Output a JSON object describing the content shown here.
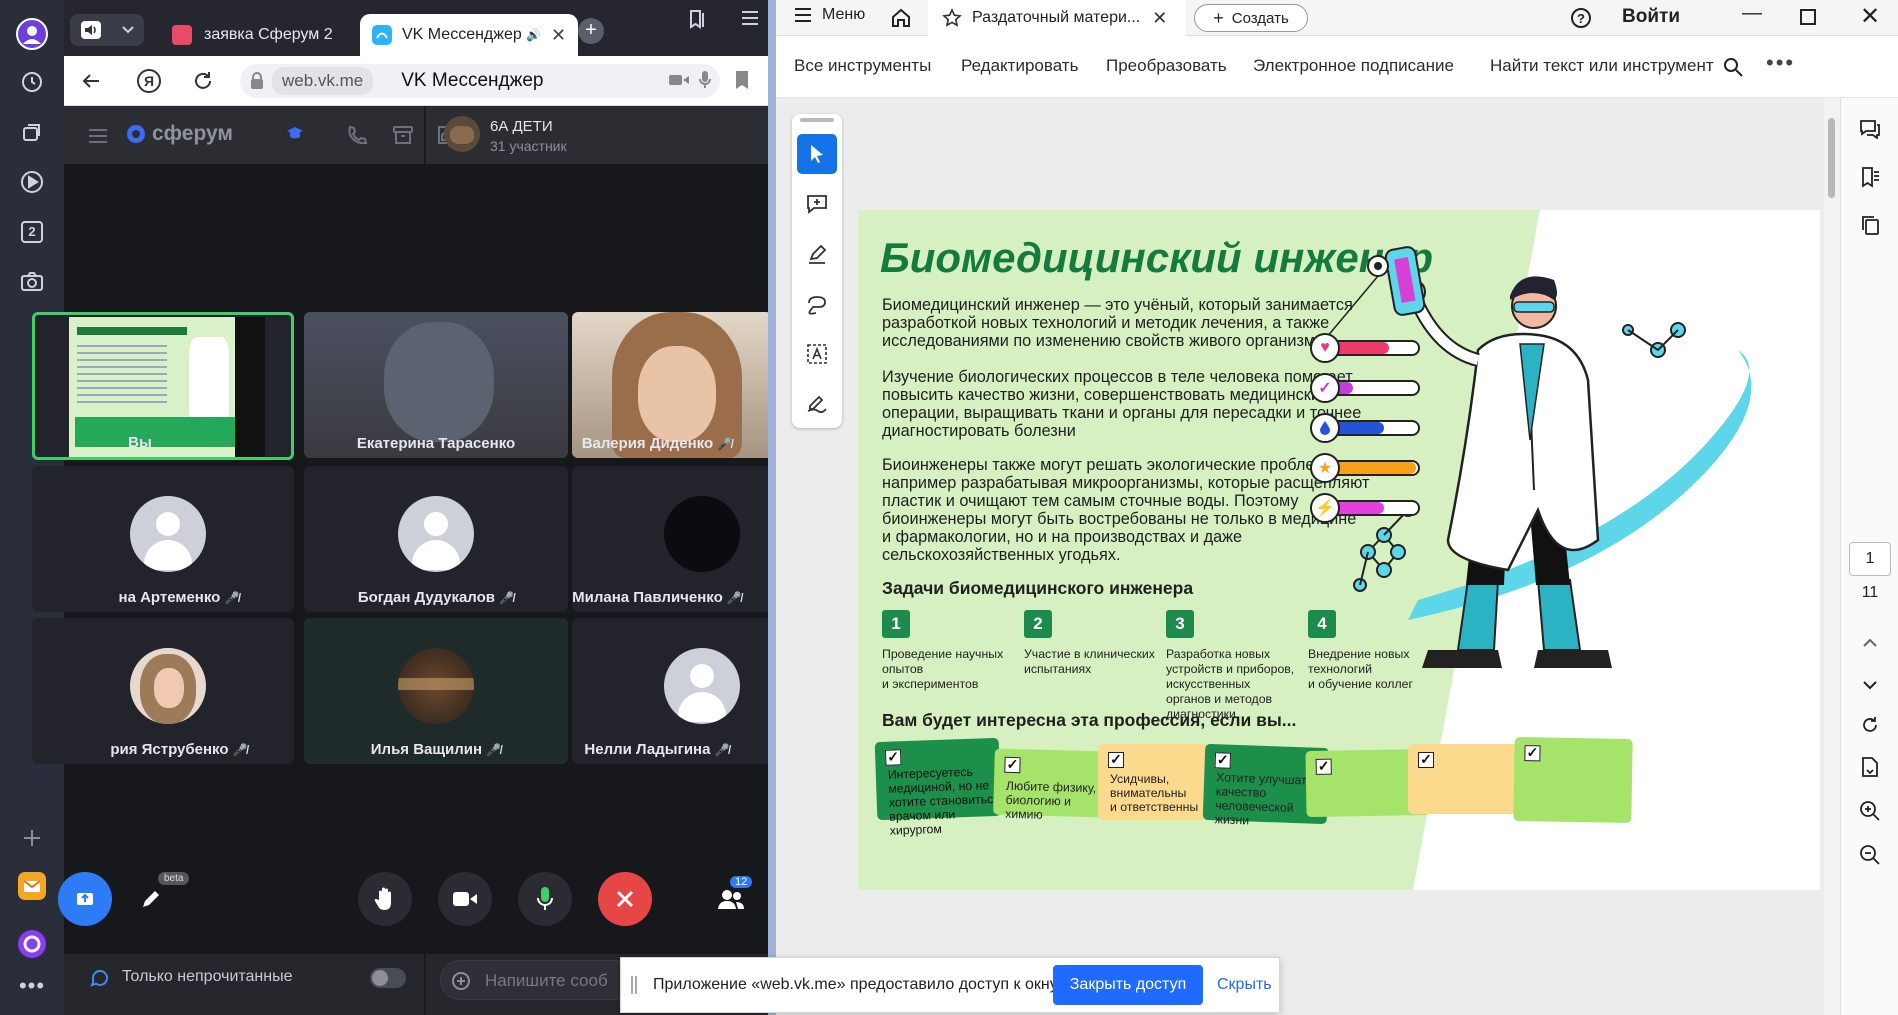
{
  "browser": {
    "tabs": [
      {
        "title": "заявка Сферум 2"
      },
      {
        "title": "VK Мессенджер"
      }
    ],
    "url": "web.vk.me",
    "page_title": "VK Мессенджер",
    "panel_badge": "2"
  },
  "vk": {
    "brand": "сферум",
    "chat_title": "6А ДЕТИ",
    "chat_members": "31 участник",
    "participants": [
      {
        "name": "Вы"
      },
      {
        "name": "Екатерина Тарасенко"
      },
      {
        "name": "Валерия Диденко"
      },
      {
        "name": "на Артеменко"
      },
      {
        "name": "Богдан Дудукалов"
      },
      {
        "name": "Милана Павличенко"
      },
      {
        "name": "рия Яструбенко"
      },
      {
        "name": "Илья Ващилин"
      },
      {
        "name": "Нелли Ладыгина"
      }
    ],
    "beta_label": "beta",
    "participants_count": "12",
    "unread_only_label": "Только непрочитанные",
    "message_placeholder": "Напишите сооб"
  },
  "notification": {
    "text": "Приложение «web.vk.me» предоставило доступ к окну.",
    "revoke_label": "Закрыть доступ",
    "hide_label": "Скрыть"
  },
  "acrobat": {
    "menu_label": "Меню",
    "tab_title": "Раздаточный матери...",
    "create_label": "Создать",
    "sign_in_label": "Войти",
    "tools": {
      "all_tools": "Все инструменты",
      "edit": "Редактировать",
      "convert": "Преобразовать",
      "e_sign": "Электронное подписание",
      "find": "Найти текст или инструмент"
    },
    "page_current": "1",
    "page_total": "11"
  },
  "doc": {
    "title": "Биомедицинский инженер",
    "p1": [
      "Биомедицинский инженер — это учёный, который занимается",
      "разработкой новых технологий и методик лечения, а также",
      "исследованиями по изменению свойств живого организма."
    ],
    "p2": [
      "Изучение биологических процессов в теле человека помогает",
      "повысить качество жизни, совершенствовать медицинские",
      "операции, выращивать ткани и органы для пересадки и точнее",
      "диагностировать болезни"
    ],
    "p3": [
      "Биоинженеры также могут решать экологические проблемы,",
      "например разрабатывая микроорганизмы, которые расщепляют",
      "пластик и очищают тем самым сточные воды. Поэтому",
      "биоинженеры могут быть востребованы не только в медицине",
      "и фармакологии, но и на производствах и даже",
      "сельскохозяйственных угодьях."
    ],
    "tasks_heading": "Задачи биомедицинского инженера",
    "tasks": [
      {
        "num": "1",
        "lines": [
          "Проведение научных",
          "опытов",
          "и экспериментов"
        ]
      },
      {
        "num": "2",
        "lines": [
          "Участие в клинических",
          "испытаниях"
        ]
      },
      {
        "num": "3",
        "lines": [
          "Разработка новых",
          "устройств и приборов,",
          "искусственных",
          "органов и методов",
          "диагностики"
        ]
      },
      {
        "num": "4",
        "lines": [
          "Внедрение новых",
          "технологий",
          "и обучение коллег"
        ]
      }
    ],
    "interest_heading": "Вам будет интересна эта профессия, если вы...",
    "cards": [
      {
        "lines": [
          "Интересуетесь",
          "медициной, но не",
          "хотите становиться",
          "врачом или хирургом"
        ],
        "color": "#1c8f4a"
      },
      {
        "lines": [
          "Любите физику,",
          "биологию и химию"
        ],
        "color": "#a6e36b"
      },
      {
        "lines": [
          "Усидчивы,",
          "внимательны",
          "и ответственны"
        ],
        "color": "#fbd98d"
      },
      {
        "lines": [
          "Хотите улучшать",
          "качество",
          "человеческой жизни"
        ],
        "color": "#1c8f4a"
      },
      {
        "lines": [],
        "color": "#a6e36b"
      },
      {
        "lines": [],
        "color": "#fbd98d"
      },
      {
        "lines": [],
        "color": "#a6e36b"
      }
    ],
    "bars": [
      {
        "icon": "heart-icon",
        "color": "#ef3b6a",
        "level": 0.68
      },
      {
        "icon": "check-icon",
        "color": "#c23fd8",
        "level": 0.28
      },
      {
        "icon": "drop-icon",
        "color": "#2453d6",
        "level": 0.62
      },
      {
        "icon": "star-icon",
        "color": "#f7a11a",
        "level": 0.98
      },
      {
        "icon": "lightning-icon",
        "color": "#e63fe0",
        "level": 0.62
      }
    ]
  },
  "colors": {
    "vk_accent": "#1f6bff",
    "acrobat_blue": "#1473e6",
    "end_call_red": "#e64646",
    "doc_green_bg": "#d6f0c2"
  }
}
